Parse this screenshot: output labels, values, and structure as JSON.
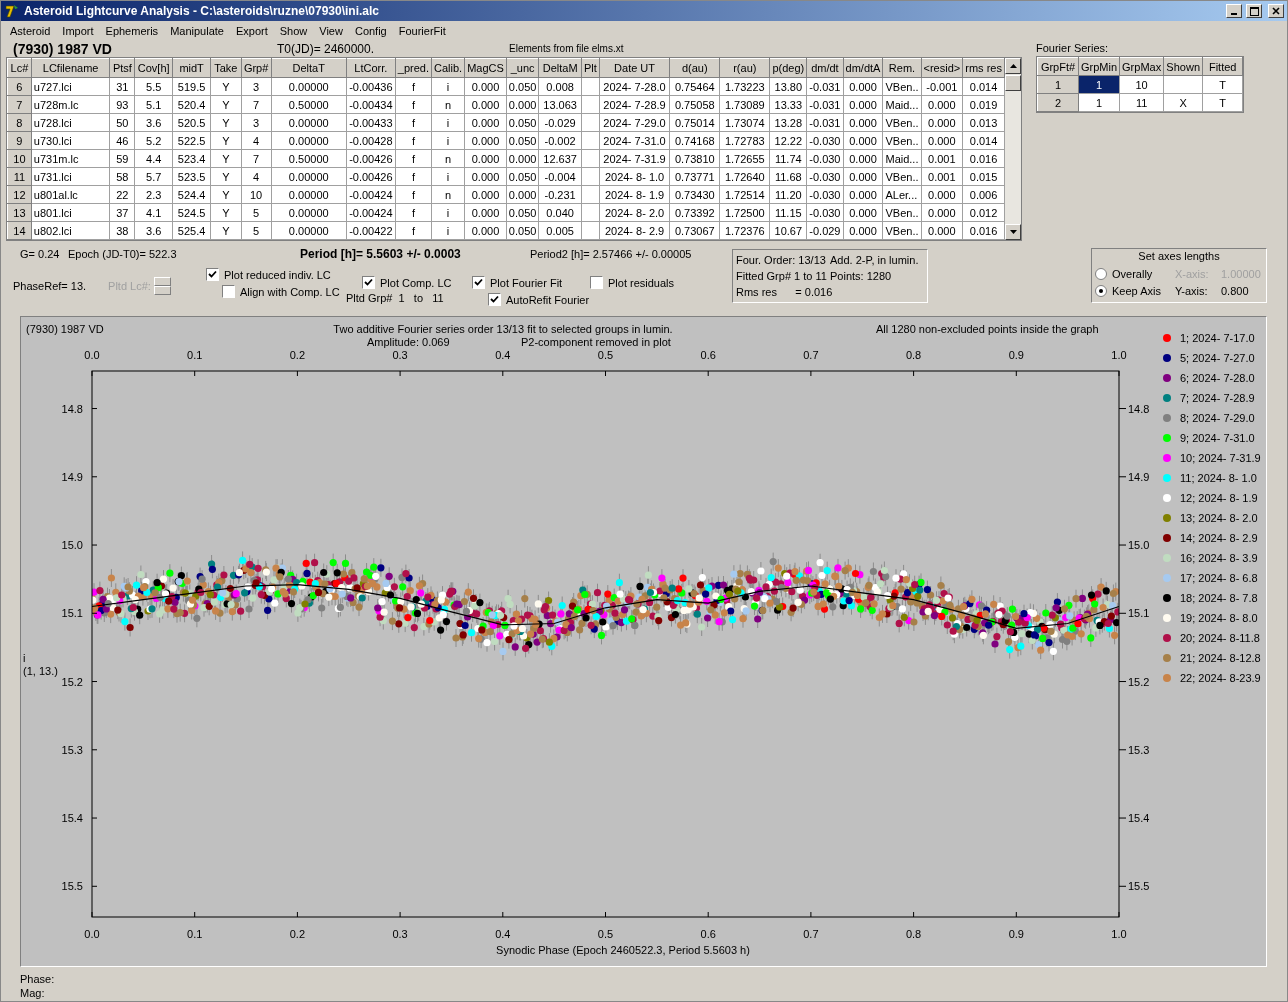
{
  "window": {
    "title": "Asteroid Lightcurve Analysis - C:\\asteroids\\ruzne\\07930\\ini.alc"
  },
  "menu": [
    "Asteroid",
    "Import",
    "Ephemeris",
    "Manipulate",
    "Export",
    "Show",
    "View",
    "Config",
    "FourierFit"
  ],
  "header": {
    "object": "(7930) 1987 VD",
    "t0": "T0(JD)= 2460000.",
    "elements": "Elements from file elms.xt"
  },
  "lc_table": {
    "columns": [
      "Lc#",
      "LCfilename",
      "Ptsf",
      "Cov[h]",
      "midT",
      "Take",
      "Grp#",
      "DeltaT",
      "LtCorr.",
      "_pred.",
      "Calib.",
      "MagCS",
      "_unc",
      "DeltaM",
      "Plt",
      "Date UT",
      "d(au)",
      "r(au)",
      "p(deg)",
      "dm/dt",
      "dm/dtA",
      "Rem.",
      "<resid>",
      "rms res"
    ],
    "rows": [
      {
        "cells": [
          "6",
          "u727.lci",
          "31",
          "5.5",
          "519.5",
          "Y",
          "3",
          "0.00000",
          "-0.00436",
          "f",
          "i",
          "0.000",
          "0.050",
          "0.008",
          "",
          "2024- 7-28.0",
          "0.75464",
          "1.73223",
          "13.80",
          "-0.031",
          "0.000",
          "VBen..",
          "-0.001",
          "0.014"
        ]
      },
      {
        "cells": [
          "7",
          "u728m.lc",
          "93",
          "5.1",
          "520.4",
          "Y",
          "7",
          "0.50000",
          "-0.00434",
          "f",
          "n",
          "0.000",
          "0.000",
          "13.063",
          "",
          "2024- 7-28.9",
          "0.75058",
          "1.73089",
          "13.33",
          "-0.031",
          "0.000",
          "Maid...",
          "0.000",
          "0.019"
        ]
      },
      {
        "cells": [
          "8",
          "u728.lci",
          "50",
          "3.6",
          "520.5",
          "Y",
          "3",
          "0.00000",
          "-0.00433",
          "f",
          "i",
          "0.000",
          "0.050",
          "-0.029",
          "",
          "2024- 7-29.0",
          "0.75014",
          "1.73074",
          "13.28",
          "-0.031",
          "0.000",
          "VBen..",
          "0.000",
          "0.013"
        ]
      },
      {
        "cells": [
          "9",
          "u730.lci",
          "46",
          "5.2",
          "522.5",
          "Y",
          "4",
          "0.00000",
          "-0.00428",
          "f",
          "i",
          "0.000",
          "0.050",
          "-0.002",
          "",
          "2024- 7-31.0",
          "0.74168",
          "1.72783",
          "12.22",
          "-0.030",
          "0.000",
          "VBen..",
          "0.000",
          "0.014"
        ]
      },
      {
        "cells": [
          "10",
          "u731m.lc",
          "59",
          "4.4",
          "523.4",
          "Y",
          "7",
          "0.50000",
          "-0.00426",
          "f",
          "n",
          "0.000",
          "0.000",
          "12.637",
          "",
          "2024- 7-31.9",
          "0.73810",
          "1.72655",
          "11.74",
          "-0.030",
          "0.000",
          "Maid...",
          "0.001",
          "0.016"
        ]
      },
      {
        "cells": [
          "11",
          "u731.lci",
          "58",
          "5.7",
          "523.5",
          "Y",
          "4",
          "0.00000",
          "-0.00426",
          "f",
          "i",
          "0.000",
          "0.050",
          "-0.004",
          "",
          "2024- 8- 1.0",
          "0.73771",
          "1.72640",
          "11.68",
          "-0.030",
          "0.000",
          "VBen..",
          "0.001",
          "0.015"
        ]
      },
      {
        "cells": [
          "12",
          "u801al.lc",
          "22",
          "2.3",
          "524.4",
          "Y",
          "10",
          "0.00000",
          "-0.00424",
          "f",
          "n",
          "0.000",
          "0.000",
          "-0.231",
          "",
          "2024- 8- 1.9",
          "0.73430",
          "1.72514",
          "11.20",
          "-0.030",
          "0.000",
          "ALer...",
          "0.000",
          "0.006"
        ]
      },
      {
        "cells": [
          "13",
          "u801.lci",
          "37",
          "4.1",
          "524.5",
          "Y",
          "5",
          "0.00000",
          "-0.00424",
          "f",
          "i",
          "0.000",
          "0.050",
          "0.040",
          "",
          "2024- 8- 2.0",
          "0.73392",
          "1.72500",
          "11.15",
          "-0.030",
          "0.000",
          "VBen..",
          "0.000",
          "0.012"
        ]
      },
      {
        "cells": [
          "14",
          "u802.lci",
          "38",
          "3.6",
          "525.4",
          "Y",
          "5",
          "0.00000",
          "-0.00422",
          "f",
          "i",
          "0.000",
          "0.050",
          "0.005",
          "",
          "2024- 8- 2.9",
          "0.73067",
          "1.72376",
          "10.67",
          "-0.029",
          "0.000",
          "VBen..",
          "0.000",
          "0.016"
        ]
      }
    ]
  },
  "fourier": {
    "title": "Fourier Series:",
    "columns": [
      "GrpFt#",
      "GrpMin",
      "GrpMax",
      "Shown",
      "Fitted"
    ],
    "rows": [
      {
        "cells": [
          {
            "text": "1",
            "selected": false
          },
          {
            "text": "1",
            "selected": true
          },
          {
            "text": "10",
            "selected": false
          },
          {
            "selected": false
          },
          {
            "text": "T",
            "selected": false
          }
        ]
      },
      {
        "cells": [
          {
            "text": "2",
            "selected": false
          },
          {
            "text": "1",
            "selected": false
          },
          {
            "text": "11",
            "selected": false
          },
          {
            "text": "X",
            "selected": false
          },
          {
            "text": "T",
            "selected": false
          }
        ]
      }
    ]
  },
  "params": {
    "g": "G= 0.24",
    "epoch": "Epoch (JD-T0)= 522.3",
    "period": "Period [h]= 5.5603 +/- 0.0003",
    "period2": "Period2 [h]= 2.57466 +/- 0.00005",
    "phase_ref": "PhaseRef= 13.",
    "pltd_lc": {
      "label": "Pltd Lc#:",
      "disabled": true
    },
    "pltd_grp": "Pltd Grp#  1   to   11"
  },
  "checkboxes": [
    {
      "label": "Plot reduced indiv. LC",
      "checked": true
    },
    {
      "label": "Align with Comp. LC",
      "checked": false
    },
    {
      "label": "Plot Comp. LC",
      "checked": true
    },
    {
      "label": "Plot Fourier Fit",
      "checked": true
    },
    {
      "label": "AutoRefit Fourier",
      "checked": true
    },
    {
      "label": "Plot residuals",
      "checked": false
    }
  ],
  "fit_info": [
    "Four. Order: 13/13",
    "Add. 2-P, in lumin.",
    "Fitted Grp# 1 to 11",
    "Points: 1280",
    "Rms res      = 0.016"
  ],
  "axes": {
    "title": "Set axes lengths",
    "options": [
      {
        "label": "Overally",
        "selected": false
      },
      {
        "label": "Keep Axis",
        "selected": true
      }
    ],
    "x_label": "X-axis:",
    "x_value": "1.00000",
    "x_disabled": true,
    "y_label": "Y-axis:",
    "y_value": "0.800"
  },
  "chart": {
    "object": "(7930) 1987 VD",
    "title": "Two additive Fourier series order 13/13 fit to selected groups in lumin.",
    "amplitude": "Amplitude: 0.069",
    "p2_note": "P2-component removed in plot",
    "points_note": "All 1280 non-excluded points inside the graph",
    "ylabel_note": "(1, 13.)",
    "top_tick_labels": [
      "0.0",
      "0.1",
      "0.2",
      "0.3",
      "0.4",
      "0.5",
      "0.6",
      "0.7",
      "0.8",
      "0.9",
      "1.0"
    ],
    "right_tick_labels": [
      "14.8",
      "14.9",
      "15.0",
      "15.1",
      "15.2",
      "15.3",
      "15.4",
      "15.5"
    ],
    "legend": [
      {
        "name": "1; 2024- 7-17.0",
        "color": "#ff0000"
      },
      {
        "name": "5; 2024- 7-27.0",
        "color": "#000080"
      },
      {
        "name": "6; 2024- 7-28.0",
        "color": "#800080"
      },
      {
        "name": "7; 2024- 7-28.9",
        "color": "#008080"
      },
      {
        "name": "8; 2024- 7-29.0",
        "color": "#808080"
      },
      {
        "name": "9; 2024- 7-31.0",
        "color": "#00ff00"
      },
      {
        "name": "10; 2024- 7-31.9",
        "color": "#ff00ff"
      },
      {
        "name": "11; 2024- 8- 1.0",
        "color": "#00ffff"
      },
      {
        "name": "12; 2024- 8- 1.9",
        "color": "#ffffff"
      },
      {
        "name": "13; 2024- 8- 2.0",
        "color": "#808000"
      },
      {
        "name": "14; 2024- 8- 2.9",
        "color": "#800000"
      },
      {
        "name": "16; 2024- 8- 3.9",
        "color": "#c0dcc0"
      },
      {
        "name": "17; 2024- 8- 6.8",
        "color": "#a6caf0"
      },
      {
        "name": "18; 2024- 8- 7.8",
        "color": "#000000"
      },
      {
        "name": "19; 2024- 8- 8.0",
        "color": "#fffbf0"
      },
      {
        "name": "20; 2024- 8-11.8",
        "color": "#b0104a"
      },
      {
        "name": "21; 2024- 8-12.8",
        "color": "#a6804a"
      },
      {
        "name": "22; 2024- 8-23.9",
        "color": "#c8844a"
      }
    ],
    "chart_data": {
      "type": "line",
      "xlabel": "Synodic Phase (Epoch 2460522.3, Period 5.5603 h)",
      "ylabel": "i",
      "x": [
        0,
        0.05,
        0.1,
        0.15,
        0.2,
        0.25,
        0.3,
        0.35,
        0.4,
        0.45,
        0.5,
        0.55,
        0.6,
        0.65,
        0.7,
        0.75,
        0.8,
        0.85,
        0.9,
        0.95,
        1
      ],
      "series": [
        {
          "color": "#000000",
          "values": [
            15.09,
            15.08,
            15.07,
            15.06,
            15.058,
            15.065,
            15.078,
            15.098,
            15.117,
            15.115,
            15.092,
            15.08,
            15.085,
            15.068,
            15.06,
            15.07,
            15.08,
            15.1,
            15.122,
            15.115,
            15.09
          ]
        }
      ],
      "xlim": [
        0,
        1
      ],
      "ylim": [
        15.545,
        14.745
      ],
      "xticks": [
        {
          "value": 0,
          "label": "0.0"
        },
        0.1,
        0.2,
        0.3,
        0.4,
        0.5,
        0.6,
        0.7,
        0.8,
        0.9,
        {
          "value": 1,
          "label": "1.0"
        }
      ],
      "yticks": [
        14.8,
        14.9,
        {
          "value": 15,
          "label": "15.0"
        },
        15.1,
        15.2,
        15.3,
        15.4,
        15.5
      ]
    }
  },
  "status": [
    "Phase:",
    "Mag:"
  ]
}
